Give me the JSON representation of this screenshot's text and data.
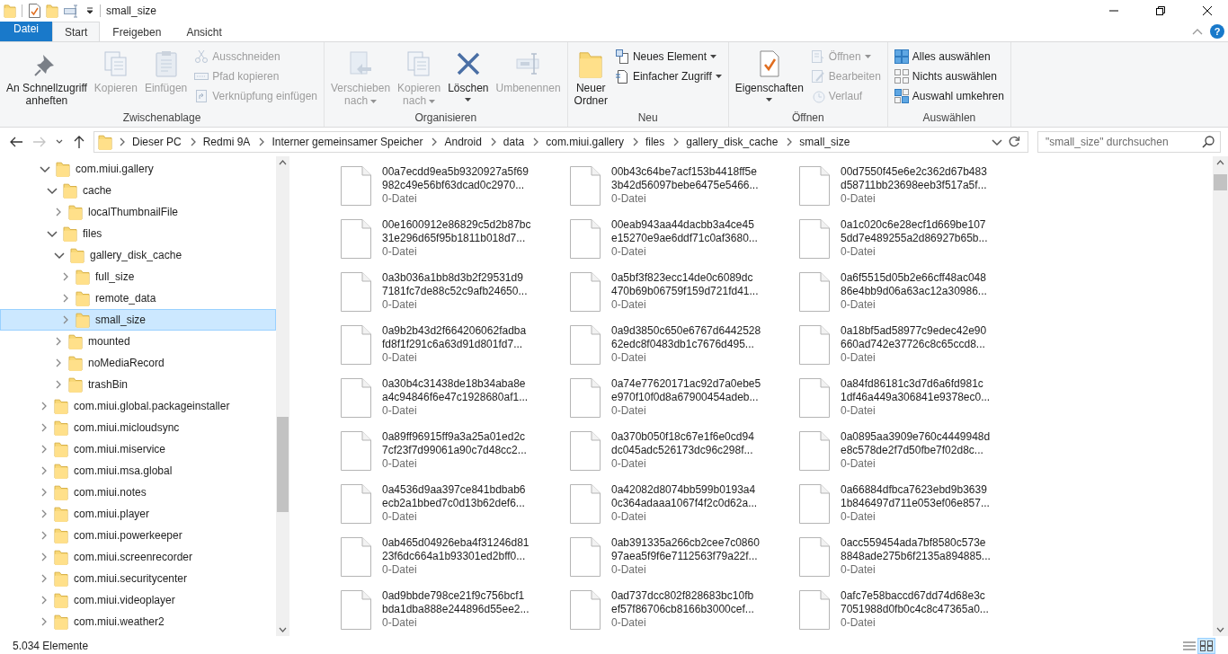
{
  "title_bar": {
    "title": "small_size"
  },
  "help": "?",
  "tabs": [
    {
      "label": "Datei",
      "kind": "file",
      "selected": false
    },
    {
      "label": "Start",
      "kind": "tab",
      "selected": true
    },
    {
      "label": "Freigeben",
      "kind": "tab",
      "selected": false
    },
    {
      "label": "Ansicht",
      "kind": "tab",
      "selected": false
    }
  ],
  "ribbon": [
    {
      "label": "Zwischenablage",
      "items": [
        {
          "label": "An Schnellzugriff\nanheften",
          "kind": "large",
          "disabled": false,
          "dropdown": false
        },
        {
          "label": "Kopieren",
          "kind": "large",
          "disabled": true,
          "dropdown": false
        },
        {
          "label": "Einfügen",
          "kind": "large",
          "disabled": true,
          "dropdown": false
        },
        {
          "label": "Ausschneiden",
          "kind": "small",
          "disabled": true,
          "dropdown": false
        },
        {
          "label": "Pfad kopieren",
          "kind": "small",
          "disabled": true,
          "dropdown": false
        },
        {
          "label": "Verknüpfung einfügen",
          "kind": "small",
          "disabled": true,
          "dropdown": false
        }
      ]
    },
    {
      "label": "Organisieren",
      "items": [
        {
          "label": "Verschieben\nnach",
          "kind": "large",
          "disabled": true,
          "dropdown": true
        },
        {
          "label": "Kopieren\nnach",
          "kind": "large",
          "disabled": true,
          "dropdown": true
        },
        {
          "label": "Löschen",
          "kind": "large",
          "disabled": false,
          "dropdown": true
        },
        {
          "label": "Umbenennen",
          "kind": "large",
          "disabled": true,
          "dropdown": false
        }
      ]
    },
    {
      "label": "Neu",
      "items": [
        {
          "label": "Neuer\nOrdner",
          "kind": "large",
          "disabled": false,
          "dropdown": false
        },
        {
          "label": "Neues Element",
          "kind": "small",
          "disabled": false,
          "dropdown": true
        },
        {
          "label": "Einfacher Zugriff",
          "kind": "small",
          "disabled": false,
          "dropdown": true
        }
      ]
    },
    {
      "label": "Öffnen",
      "items": [
        {
          "label": "Eigenschaften",
          "kind": "large",
          "disabled": false,
          "dropdown": true
        },
        {
          "label": "Öffnen",
          "kind": "small",
          "disabled": true,
          "dropdown": true
        },
        {
          "label": "Bearbeiten",
          "kind": "small",
          "disabled": true,
          "dropdown": false
        },
        {
          "label": "Verlauf",
          "kind": "small",
          "disabled": true,
          "dropdown": false
        }
      ]
    },
    {
      "label": "Auswählen",
      "items": [
        {
          "label": "Alles auswählen",
          "kind": "small",
          "disabled": false,
          "dropdown": false
        },
        {
          "label": "Nichts auswählen",
          "kind": "small",
          "disabled": false,
          "dropdown": false
        },
        {
          "label": "Auswahl umkehren",
          "kind": "small",
          "disabled": false,
          "dropdown": false
        }
      ]
    }
  ],
  "address": {
    "forward_disabled": true,
    "path": [
      "Dieser PC",
      "Redmi 9A",
      "Interner gemeinsamer Speicher",
      "Android",
      "data",
      "com.miui.gallery",
      "files",
      "gallery_disk_cache",
      "small_size"
    ],
    "search_placeholder": "\"small_size\" durchsuchen"
  },
  "nav": [
    {
      "label": "com.miui.gallery",
      "expanded": true,
      "selected": false,
      "children": [
        {
          "label": "cache",
          "expanded": true,
          "selected": false,
          "children": [
            {
              "label": "localThumbnailFile",
              "expanded": false,
              "selected": false
            }
          ]
        },
        {
          "label": "files",
          "expanded": true,
          "selected": false,
          "children": [
            {
              "label": "gallery_disk_cache",
              "expanded": true,
              "selected": false,
              "children": [
                {
                  "label": "full_size",
                  "expanded": false,
                  "selected": false
                },
                {
                  "label": "remote_data",
                  "expanded": false,
                  "selected": false
                },
                {
                  "label": "small_size",
                  "expanded": false,
                  "selected": true
                }
              ]
            },
            {
              "label": "mounted",
              "expanded": false,
              "selected": false
            },
            {
              "label": "noMediaRecord",
              "expanded": false,
              "selected": false
            },
            {
              "label": "trashBin",
              "expanded": false,
              "selected": false
            }
          ]
        }
      ]
    },
    {
      "label": "com.miui.global.packageinstaller",
      "expanded": false,
      "selected": false
    },
    {
      "label": "com.miui.micloudsync",
      "expanded": false,
      "selected": false
    },
    {
      "label": "com.miui.miservice",
      "expanded": false,
      "selected": false
    },
    {
      "label": "com.miui.msa.global",
      "expanded": false,
      "selected": false
    },
    {
      "label": "com.miui.notes",
      "expanded": false,
      "selected": false
    },
    {
      "label": "com.miui.player",
      "expanded": false,
      "selected": false
    },
    {
      "label": "com.miui.powerkeeper",
      "expanded": false,
      "selected": false
    },
    {
      "label": "com.miui.screenrecorder",
      "expanded": false,
      "selected": false
    },
    {
      "label": "com.miui.securitycenter",
      "expanded": false,
      "selected": false
    },
    {
      "label": "com.miui.videoplayer",
      "expanded": false,
      "selected": false
    },
    {
      "label": "com.miui.weather2",
      "expanded": false,
      "selected": false
    }
  ],
  "files": [
    {
      "name_lines": [
        "00a7ecdd9ea5b9320927a5f69",
        "982c49e56bf63dcad0c2970..."
      ],
      "type": "0-Datei"
    },
    {
      "name_lines": [
        "00b43c64be7acf153b4418ff5e",
        "3b42d56097bebe6475e5466..."
      ],
      "type": "0-Datei"
    },
    {
      "name_lines": [
        "00d7550f45e6e2c362d67b483",
        "d58711bb23698eeb3f517a5f..."
      ],
      "type": "0-Datei"
    },
    {
      "name_lines": [
        "00e1600912e86829c5d2b87bc",
        "31e296d65f95b1811b018d7..."
      ],
      "type": "0-Datei"
    },
    {
      "name_lines": [
        "00eab943aa44dacbb3a4ce45",
        "e15270e9ae6ddf71c0af3680..."
      ],
      "type": "0-Datei"
    },
    {
      "name_lines": [
        "0a1c020c6e28ecf1d669be107",
        "5dd7e489255a2d86927b65b..."
      ],
      "type": "0-Datei"
    },
    {
      "name_lines": [
        "0a3b036a1bb8d3b2f29531d9",
        "7181fc7de88c52c9afb24650..."
      ],
      "type": "0-Datei"
    },
    {
      "name_lines": [
        "0a5bf3f823ecc14de0c6089dc",
        "470b69b06759f159d721fd41..."
      ],
      "type": "0-Datei"
    },
    {
      "name_lines": [
        "0a6f5515d05b2e66cff48ac048",
        "86e4bb9d06a63ac12a30986..."
      ],
      "type": "0-Datei"
    },
    {
      "name_lines": [
        "0a9b2b43d2f664206062fadba",
        "fd8f1f291c6a63d91d801fd7..."
      ],
      "type": "0-Datei"
    },
    {
      "name_lines": [
        "0a9d3850c650e6767d6442528",
        "62edc8f0483db1c7676d495..."
      ],
      "type": "0-Datei"
    },
    {
      "name_lines": [
        "0a18bf5ad58977c9edec42e90",
        "660ad742e37726c8c65ccd8..."
      ],
      "type": "0-Datei"
    },
    {
      "name_lines": [
        "0a30b4c31438de18b34aba8e",
        "a4c94846f6e47c1928680af1..."
      ],
      "type": "0-Datei"
    },
    {
      "name_lines": [
        "0a74e77620171ac92d7a0ebe5",
        "e970f10f0d8a67900454adeb..."
      ],
      "type": "0-Datei"
    },
    {
      "name_lines": [
        "0a84fd86181c3d7d6a6fd981c",
        "1df46a449a306841e9378ec0..."
      ],
      "type": "0-Datei"
    },
    {
      "name_lines": [
        "0a89ff96915ff9a3a25a01ed2c",
        "7cf23f7d99061a90c7d48cc2..."
      ],
      "type": "0-Datei"
    },
    {
      "name_lines": [
        "0a370b050f18c67e1f6e0cd94",
        "dc045adc526173dc96c298f..."
      ],
      "type": "0-Datei"
    },
    {
      "name_lines": [
        "0a0895aa3909e760c4449948d",
        "e8c578de2f7d50fbe7f02d8c..."
      ],
      "type": "0-Datei"
    },
    {
      "name_lines": [
        "0a4536d9aa397ce841bdbab6",
        "ecb2a1bbed7c0d13b62def6..."
      ],
      "type": "0-Datei"
    },
    {
      "name_lines": [
        "0a42082d8074bb599b0193a4",
        "0c364adaaa1067f4f2c0d62a..."
      ],
      "type": "0-Datei"
    },
    {
      "name_lines": [
        "0a66884dfbca7623ebd9b3639",
        "1b846497d711e053ef06e857..."
      ],
      "type": "0-Datei"
    },
    {
      "name_lines": [
        "0ab465d04926eba4f31246d81",
        "23f6dc664a1b93301ed2bff0..."
      ],
      "type": "0-Datei"
    },
    {
      "name_lines": [
        "0ab391335a266cb2cee7c0860",
        "97aea5f9f6e7112563f79a22f..."
      ],
      "type": "0-Datei"
    },
    {
      "name_lines": [
        "0acc559454ada7bf8580c573e",
        "8848ade275b6f2135a894885..."
      ],
      "type": "0-Datei"
    },
    {
      "name_lines": [
        "0ad9bbde798ce21f9c756bcf1",
        "bda1dba888e244896d55ee2..."
      ],
      "type": "0-Datei"
    },
    {
      "name_lines": [
        "0ad737dcc802f828683bc10fb",
        "ef57f86706cb8166b3000cef..."
      ],
      "type": "0-Datei"
    },
    {
      "name_lines": [
        "0afc7e58baccd67dd74d68e3c",
        "7051988d0fb0c4c8c47365a0..."
      ],
      "type": "0-Datei"
    }
  ],
  "status_bar": {
    "count": "5.034 Elemente"
  }
}
